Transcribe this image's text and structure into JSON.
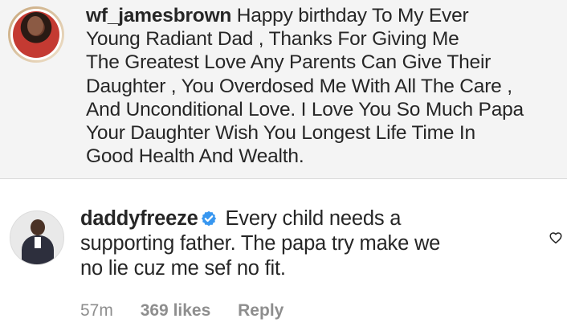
{
  "caption": {
    "username": "wf_jamesbrown",
    "text": " Happy birthday To My Ever\nYoung Radiant Dad , Thanks For Giving Me\nThe Greatest Love Any Parents Can Give Their\nDaughter , You Overdosed Me With All The Care ,\nAnd Unconditional Love. I Love You So Much Papa\nYour Daughter Wish You Longest Life Time In\nGood Health And Wealth.",
    "avatar_icon": "profile-photo-woman"
  },
  "comment": {
    "username": "daddyfreeze",
    "verified": true,
    "text": " Every child needs a\nsupporting father. The papa try make we\nno lie cuz me sef no fit.",
    "avatar_icon": "profile-photo-man",
    "time": "57m",
    "likes": "369 likes",
    "reply_label": "Reply",
    "heart_icon": "heart-outline-icon"
  },
  "colors": {
    "caption_background": "#f4f4f4",
    "text": "#262626",
    "meta_text": "#8e8e8e",
    "verified_blue": "#3897f0"
  }
}
